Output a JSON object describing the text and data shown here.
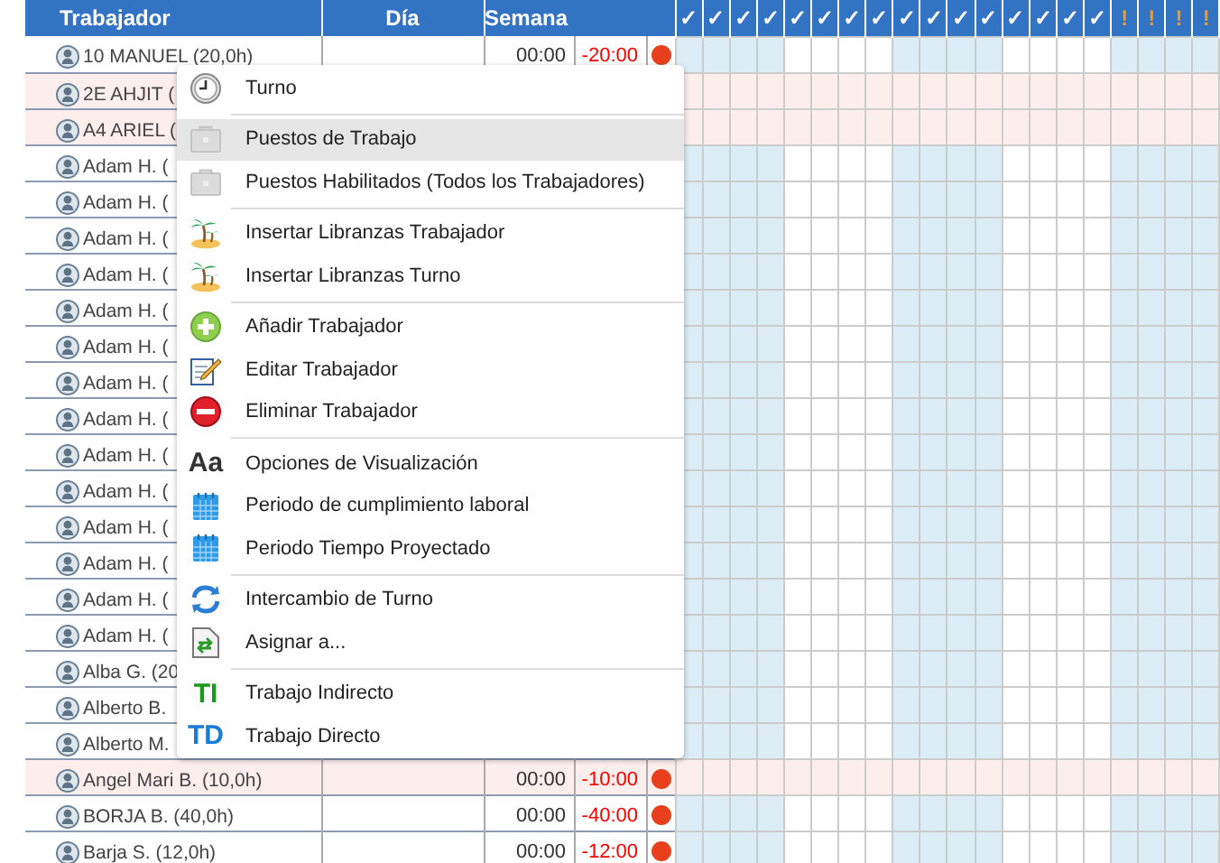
{
  "table": {
    "columns": [
      "Trabajador",
      "Día",
      "Semana"
    ],
    "day_columns": [
      {
        "kind": "ok",
        "symbol": "✓",
        "shaded": true
      },
      {
        "kind": "ok",
        "symbol": "✓",
        "shaded": true
      },
      {
        "kind": "ok",
        "symbol": "✓",
        "shaded": true
      },
      {
        "kind": "ok",
        "symbol": "✓",
        "shaded": true
      },
      {
        "kind": "ok",
        "symbol": "✓",
        "shaded": false
      },
      {
        "kind": "ok",
        "symbol": "✓",
        "shaded": false
      },
      {
        "kind": "ok",
        "symbol": "✓",
        "shaded": false
      },
      {
        "kind": "ok",
        "symbol": "✓",
        "shaded": false
      },
      {
        "kind": "ok",
        "symbol": "✓",
        "shaded": true
      },
      {
        "kind": "ok",
        "symbol": "✓",
        "shaded": true
      },
      {
        "kind": "ok",
        "symbol": "✓",
        "shaded": true
      },
      {
        "kind": "ok",
        "symbol": "✓",
        "shaded": true
      },
      {
        "kind": "ok",
        "symbol": "✓",
        "shaded": false
      },
      {
        "kind": "ok",
        "symbol": "✓",
        "shaded": false
      },
      {
        "kind": "ok",
        "symbol": "✓",
        "shaded": false
      },
      {
        "kind": "ok",
        "symbol": "✓",
        "shaded": false
      },
      {
        "kind": "warning",
        "symbol": "!",
        "shaded": true
      },
      {
        "kind": "warning",
        "symbol": "!",
        "shaded": true
      },
      {
        "kind": "warning",
        "symbol": "!",
        "shaded": true
      },
      {
        "kind": "warning",
        "symbol": "!",
        "shaded": true
      }
    ],
    "rows": [
      {
        "name": "10 MANUEL (20,0h)",
        "flagged": false,
        "week": "00:00",
        "balance": "-20:00",
        "color": "#e8401c"
      },
      {
        "name": "2E AHJIT (",
        "flagged": true
      },
      {
        "name": "A4 ARIEL (",
        "flagged": true
      },
      {
        "name": "Adam H. (",
        "flagged": false
      },
      {
        "name": "Adam H. (",
        "flagged": false
      },
      {
        "name": "Adam H. (",
        "flagged": false
      },
      {
        "name": "Adam H. (",
        "flagged": false
      },
      {
        "name": "Adam H. (",
        "flagged": false
      },
      {
        "name": "Adam H. (",
        "flagged": false
      },
      {
        "name": "Adam H. (",
        "flagged": false
      },
      {
        "name": "Adam H. (",
        "flagged": false
      },
      {
        "name": "Adam H. (",
        "flagged": false
      },
      {
        "name": "Adam H. (",
        "flagged": false
      },
      {
        "name": "Adam H. (",
        "flagged": false
      },
      {
        "name": "Adam H. (",
        "flagged": false
      },
      {
        "name": "Adam H. (",
        "flagged": false
      },
      {
        "name": "Adam H. (",
        "flagged": false
      },
      {
        "name": "Alba G. (20",
        "flagged": false
      },
      {
        "name": "Alberto B.",
        "flagged": false
      },
      {
        "name": "Alberto M.",
        "flagged": false
      },
      {
        "name": "Angel Mari B. (10,0h)",
        "flagged": true,
        "week": "00:00",
        "balance": "-10:00",
        "color": "#e8401c"
      },
      {
        "name": "BORJA B. (40,0h)",
        "flagged": false,
        "week": "00:00",
        "balance": "-40:00",
        "color": "#e8401c"
      },
      {
        "name": "Barja S. (12,0h)",
        "flagged": false,
        "week": "00:00",
        "balance": "-12:00",
        "color": "#e8401c"
      }
    ]
  },
  "context_menu": {
    "groups": [
      [
        {
          "label": "Turno",
          "kind": "clock",
          "selected": false
        }
      ],
      [
        {
          "label": "Puestos de Trabajo",
          "kind": "briefcase",
          "selected": true
        },
        {
          "label": "Puestos Habilitados (Todos los Trabajadores)",
          "kind": "briefcase",
          "selected": false
        }
      ],
      [
        {
          "label": "Insertar Libranzas Trabajador",
          "kind": "island",
          "selected": false
        },
        {
          "label": "Insertar Libranzas Turno",
          "kind": "island",
          "selected": false
        }
      ],
      [
        {
          "label": "Añadir Trabajador",
          "kind": "add",
          "selected": false
        },
        {
          "label": "Editar Trabajador",
          "kind": "edit",
          "selected": false
        },
        {
          "label": "Eliminar Trabajador",
          "kind": "delete",
          "selected": false
        }
      ],
      [
        {
          "label": "Opciones de Visualización",
          "kind": "letters",
          "icon_text": "Aa",
          "color": "#333333",
          "selected": false
        },
        {
          "label": "Periodo de cumplimiento laboral",
          "kind": "calendar",
          "selected": false
        },
        {
          "label": "Periodo Tiempo Proyectado",
          "kind": "calendar",
          "selected": false
        }
      ],
      [
        {
          "label": "Intercambio de Turno",
          "kind": "swap",
          "selected": false
        },
        {
          "label": "Asignar a...",
          "kind": "assign",
          "selected": false
        }
      ],
      [
        {
          "label": "Trabajo Indirecto",
          "kind": "letters",
          "icon_text": "TI",
          "color": "#1a9a1a",
          "selected": false
        },
        {
          "label": "Trabajo Directo",
          "kind": "letters",
          "icon_text": "TD",
          "color": "#1a7ad8",
          "selected": false
        }
      ]
    ]
  }
}
